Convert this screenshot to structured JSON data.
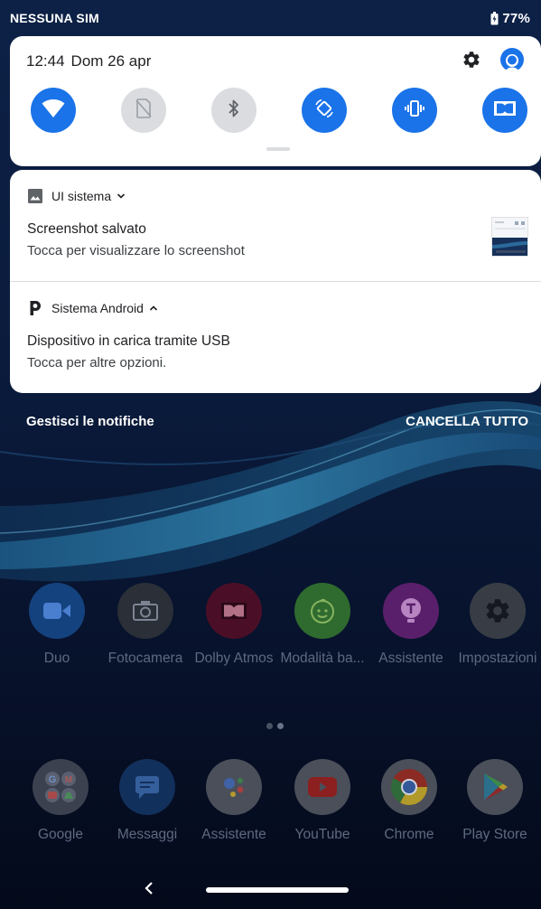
{
  "status_bar": {
    "carrier": "NESSUNA SIM",
    "battery": "77%"
  },
  "quick_settings": {
    "time": "12:44",
    "date": "Dom 26 apr",
    "tiles": [
      {
        "icon": "wifi-icon",
        "state": "on"
      },
      {
        "icon": "no-sim-icon",
        "state": "off"
      },
      {
        "icon": "bluetooth-icon",
        "state": "off"
      },
      {
        "icon": "auto-rotate-icon",
        "state": "on"
      },
      {
        "icon": "vibrate-icon",
        "state": "on"
      },
      {
        "icon": "dolby-icon",
        "state": "on"
      }
    ]
  },
  "notifications": [
    {
      "app": "UI sistema",
      "title": "Screenshot salvato",
      "text": "Tocca per visualizzare lo screenshot",
      "expanded": false
    },
    {
      "app": "Sistema Android",
      "title": "Dispositivo in carica tramite USB",
      "text": "Tocca per altre opzioni.",
      "expanded": true
    }
  ],
  "notification_footer": {
    "manage": "Gestisci le notifiche",
    "clear_all": "CANCELLA TUTTO"
  },
  "home": {
    "row1": [
      {
        "label": "Duo",
        "icon": "duo-icon",
        "color": "#1a73e8"
      },
      {
        "label": "Fotocamera",
        "icon": "camera-icon",
        "color": "#3c4043"
      },
      {
        "label": "Dolby Atmos",
        "icon": "dolby-atmos-icon",
        "color": "#8b1e3f"
      },
      {
        "label": "Modalità ba...",
        "icon": "kids-mode-icon",
        "color": "#4caf50"
      },
      {
        "label": "Assistente",
        "icon": "assistant-lenovo-icon",
        "color": "#9c27b0"
      },
      {
        "label": "Impostazioni",
        "icon": "settings-app-icon",
        "color": "#5f6368"
      }
    ],
    "row2": [
      {
        "label": "Google",
        "icon": "google-folder-icon",
        "color": "#ffffff"
      },
      {
        "label": "Messaggi",
        "icon": "messages-icon",
        "color": "#1a73e8"
      },
      {
        "label": "Assistente",
        "icon": "google-assistant-icon",
        "color": "#ffffff"
      },
      {
        "label": "YouTube",
        "icon": "youtube-icon",
        "color": "#ff0000"
      },
      {
        "label": "Chrome",
        "icon": "chrome-icon",
        "color": "#ffffff"
      },
      {
        "label": "Play Store",
        "icon": "play-store-icon",
        "color": "#ffffff"
      }
    ]
  }
}
